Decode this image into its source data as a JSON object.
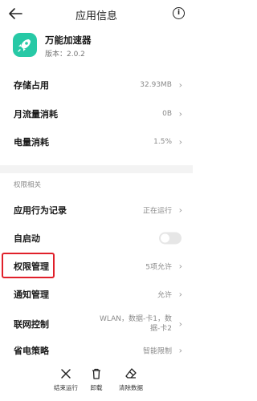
{
  "header": {
    "title": "应用信息"
  },
  "app": {
    "name": "万能加速器",
    "version": "版本：2.0.2"
  },
  "storage": {
    "label": "存储占用",
    "value": "32.93MB"
  },
  "data_usage": {
    "label": "月流量消耗",
    "value": "0B"
  },
  "battery": {
    "label": "电量消耗",
    "value": "1.5%"
  },
  "section": {
    "title": "权限相关"
  },
  "behavior": {
    "label": "应用行为记录",
    "value": "正在运行"
  },
  "autostart": {
    "label": "自启动",
    "enabled": false
  },
  "permissions": {
    "label": "权限管理",
    "value": "5项允许"
  },
  "notifications": {
    "label": "通知管理",
    "value": "允许"
  },
  "network": {
    "label": "联网控制",
    "value_line1": "WLAN，数据-卡1，数",
    "value_line2": "据-卡2"
  },
  "power": {
    "label": "省电策略",
    "value": "智能限制"
  },
  "bottom_actions": [
    {
      "label": "结束运行",
      "icon": "close-icon"
    },
    {
      "label": "卸载",
      "icon": "trash-icon"
    },
    {
      "label": "清除数据",
      "icon": "eraser-icon"
    }
  ],
  "colors": {
    "app_icon": "#27c9a6",
    "highlight": "#e0202a",
    "background": "#ffffff"
  }
}
